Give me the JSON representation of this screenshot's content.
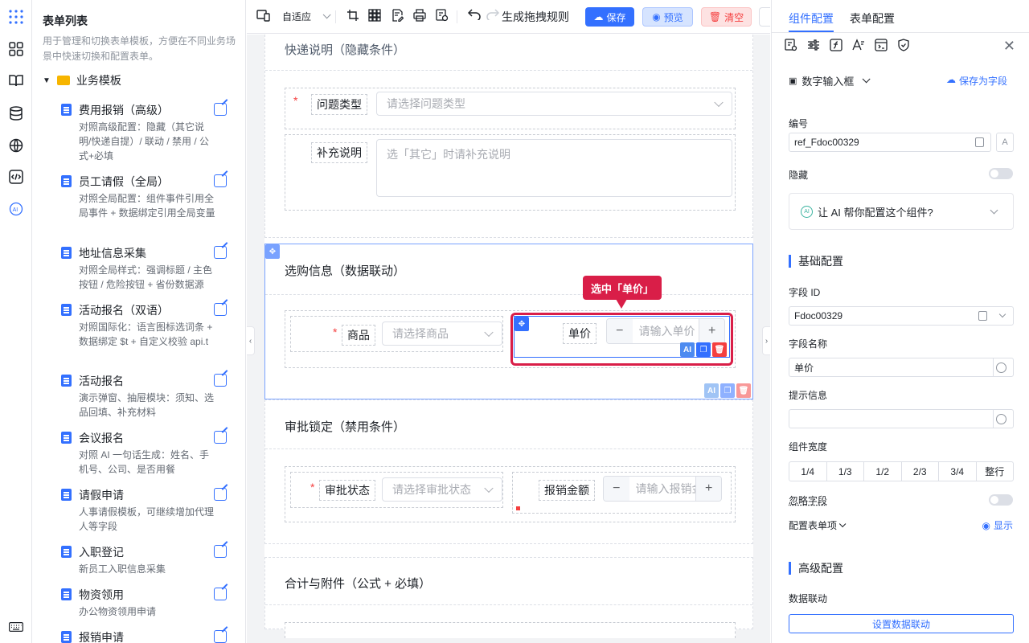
{
  "sidebar": {
    "title": "表单列表",
    "description": "用于管理和切换表单模板，方便在不同业务场景中快速切换和配置表单。",
    "folder": "业务模板",
    "items": [
      {
        "title": "费用报销（高级）",
        "desc": "对照高级配置：隐藏（其它说明/快递自提）/ 联动 / 禁用 / 公式+必填"
      },
      {
        "title": "员工请假（全局）",
        "desc": "对照全局配置：组件事件引用全局事件 + 数据绑定引用全局变量"
      },
      {
        "title": "地址信息采集",
        "desc": "对照全局样式：强调标题 / 主色按钮 / 危险按钮 + 省份数据源"
      },
      {
        "title": "活动报名（双语）",
        "desc": "对照国际化：语言图标选词条 + 数据绑定 $t + 自定义校验 api.t"
      },
      {
        "title": "活动报名",
        "desc": "演示弹窗、抽屉模块：须知、选品回填、补充材料"
      },
      {
        "title": "会议报名",
        "desc": "对照 AI 一句话生成：姓名、手机号、公司、是否用餐"
      },
      {
        "title": "请假申请",
        "desc": "人事请假模板，可继续增加代理人等字段"
      },
      {
        "title": "入职登记",
        "desc": "新员工入职信息采集"
      },
      {
        "title": "物资领用",
        "desc": "办公物资领用申请"
      },
      {
        "title": "报销申请",
        "desc": ""
      }
    ]
  },
  "toolbar": {
    "adaptive": "自适应",
    "rule_btn": "生成拖拽规则",
    "save": "保存",
    "preview": "预览",
    "clear": "清空"
  },
  "canvas": {
    "section0_title": "快递说明（隐藏条件）",
    "issue_label": "问题类型",
    "issue_placeholder": "请选择问题类型",
    "supplement_label": "补充说明",
    "supplement_placeholder": "选「其它」时请补充说明",
    "section1_title": "选购信息（数据联动）",
    "tooltip": "选中「单价」",
    "product_label": "商品",
    "product_placeholder": "请选择商品",
    "price_label": "单价",
    "price_placeholder": "请输入单价",
    "section2_title": "审批锁定（禁用条件）",
    "approval_label": "审批状态",
    "approval_placeholder": "请选择审批状态",
    "amount_label": "报销金额",
    "amount_placeholder": "请输入报销金额",
    "section3_title": "合计与附件（公式 + 必填）",
    "minus": "−",
    "plus": "+",
    "ai": "AI"
  },
  "right": {
    "tab_component": "组件配置",
    "tab_form": "表单配置",
    "component_type": "数字输入框",
    "save_as_field": "保存为字段",
    "id_label": "编号",
    "id_value": "ref_Fdoc00329",
    "hidden_label": "隐藏",
    "ai_prompt": "让 AI 帮你配置这个组件?",
    "basic_header": "基础配置",
    "field_id_label": "字段 ID",
    "field_id_value": "Fdoc00329",
    "field_name_label": "字段名称",
    "field_name_value": "单价",
    "hint_label": "提示信息",
    "hint_value": "",
    "width_label": "组件宽度",
    "widths": [
      "1/4",
      "1/3",
      "1/2",
      "2/3",
      "3/4",
      "整行"
    ],
    "ignore_label": "忽略字段",
    "config_items_label": "配置表单项",
    "show_label": "显示",
    "advanced_header": "高级配置",
    "linkage_label": "数据联动",
    "linkage_btn": "设置数据联动"
  },
  "colors": {
    "primary": "#3370ff",
    "danger": "#f53f3f",
    "select_border": "#d91e48"
  }
}
